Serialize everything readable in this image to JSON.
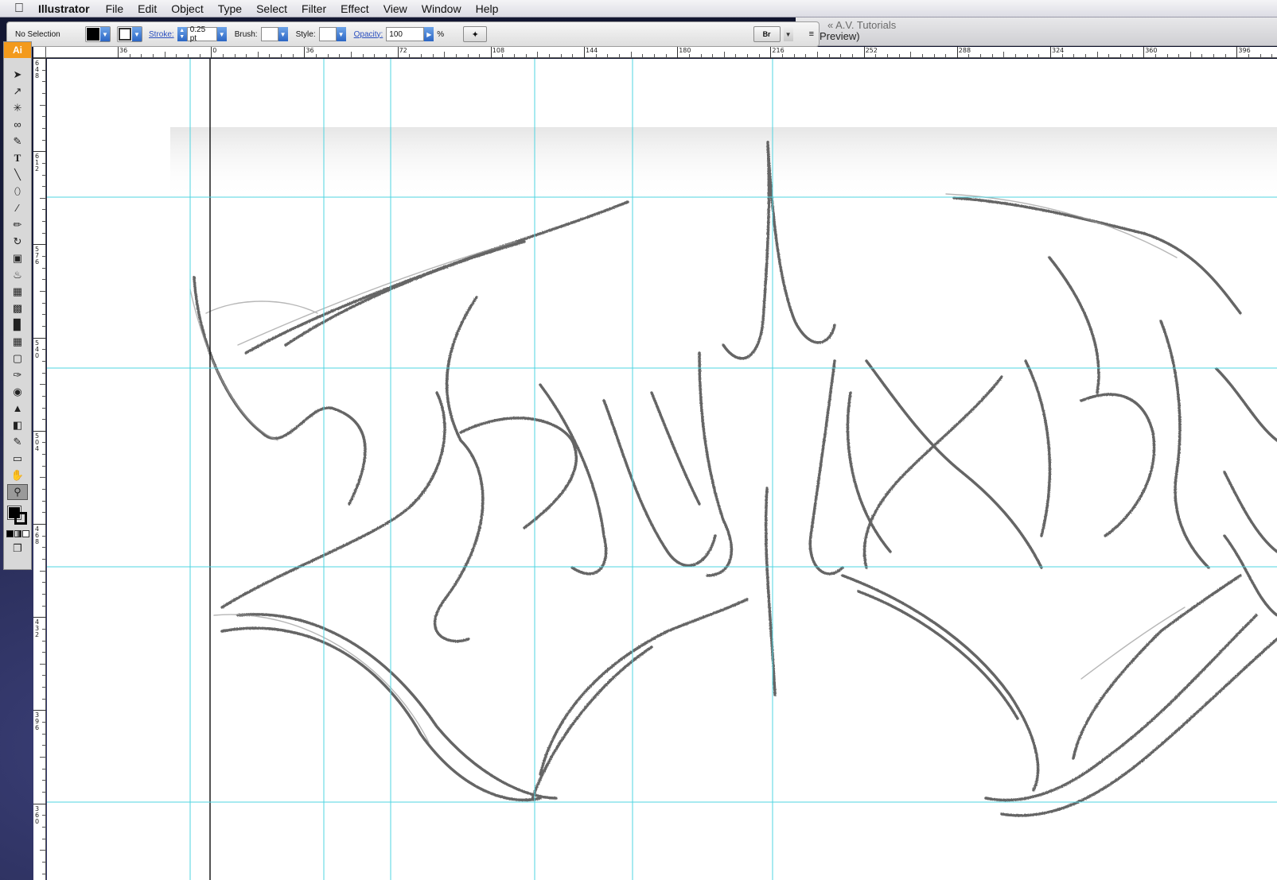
{
  "menubar": {
    "app_name": "Illustrator",
    "items": [
      "File",
      "Edit",
      "Object",
      "Type",
      "Select",
      "Filter",
      "Effect",
      "View",
      "Window",
      "Help"
    ]
  },
  "document": {
    "title_back": "« A.V. Tutorials",
    "title_front": "Preview)"
  },
  "control_panel": {
    "selection_label": "No Selection",
    "stroke_label": "Stroke:",
    "stroke_value": "0.25 pt",
    "brush_label": "Brush:",
    "style_label": "Style:",
    "opacity_label": "Opacity:",
    "opacity_value": "100",
    "percent_sign": "%"
  },
  "tools_panel": {
    "logo": "Ai"
  },
  "rulers": {
    "top_labels": [
      "36",
      "0",
      "36",
      "72",
      "108",
      "144",
      "180",
      "216",
      "252",
      "288",
      "324",
      "360",
      "396"
    ],
    "left_labels": [
      "648",
      "612",
      "576",
      "540",
      "504",
      "468",
      "432",
      "396",
      "360"
    ]
  },
  "colors": {
    "guide": "#4fd4e0",
    "accent": "#f39a1c"
  }
}
